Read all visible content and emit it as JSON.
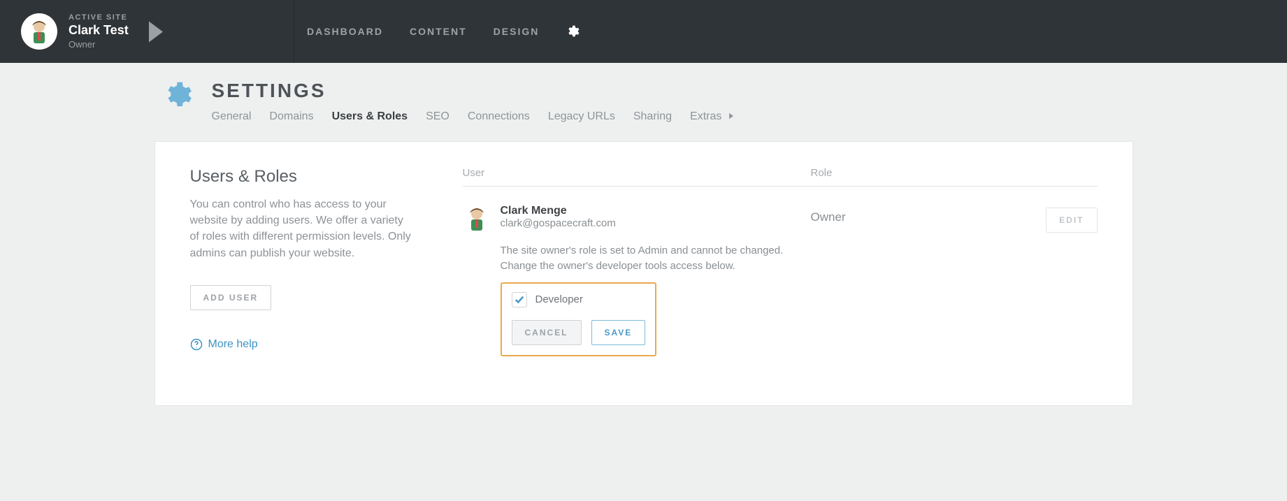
{
  "topbar": {
    "active_site_label": "ACTIVE SITE",
    "site_name": "Clark Test",
    "site_role": "Owner",
    "nav": {
      "dashboard": "DASHBOARD",
      "content": "CONTENT",
      "design": "DESIGN"
    }
  },
  "page": {
    "title": "SETTINGS",
    "subnav": {
      "general": "General",
      "domains": "Domains",
      "users_roles": "Users & Roles",
      "seo": "SEO",
      "connections": "Connections",
      "legacy_urls": "Legacy URLs",
      "sharing": "Sharing",
      "extras": "Extras"
    }
  },
  "panel": {
    "title": "Users & Roles",
    "description": "You can control who has access to your website by adding users. We offer a variety of roles with different permission levels. Only admins can publish your website.",
    "add_user_label": "ADD USER",
    "more_help_label": "More help",
    "columns": {
      "user": "User",
      "role": "Role"
    },
    "user": {
      "name": "Clark Menge",
      "email": "clark@gospacecraft.com",
      "role": "Owner",
      "edit_label": "EDIT",
      "owner_note": "The site owner's role is set to Admin and cannot be changed. Change the owner's developer tools access below.",
      "developer_label": "Developer",
      "developer_checked": true,
      "cancel_label": "CANCEL",
      "save_label": "SAVE"
    }
  }
}
